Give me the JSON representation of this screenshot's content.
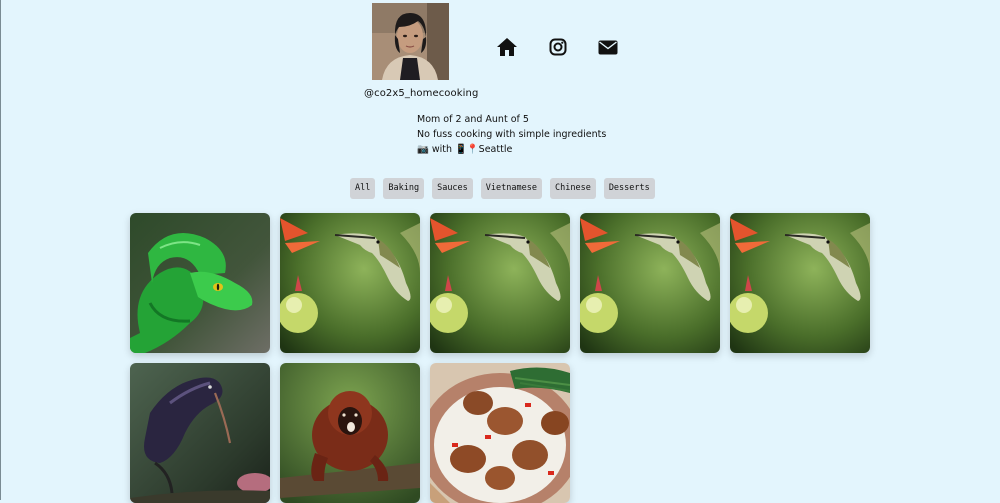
{
  "profile": {
    "handle": "@co2x5_homecooking",
    "bio": [
      "Mom of 2 and Aunt of 5",
      "No fuss cooking with simple ingredients",
      "📷 with 📱📍Seattle"
    ]
  },
  "nav": [
    {
      "icon": "home-icon"
    },
    {
      "icon": "instagram-icon"
    },
    {
      "icon": "email-icon"
    }
  ],
  "filters": [
    "All",
    "Baking",
    "Sauces",
    "Vietnamese",
    "Chinese",
    "Desserts"
  ],
  "gallery": [
    {
      "subject": "green-snake"
    },
    {
      "subject": "hummingbird"
    },
    {
      "subject": "hummingbird"
    },
    {
      "subject": "hummingbird"
    },
    {
      "subject": "hummingbird"
    },
    {
      "subject": "crow"
    },
    {
      "subject": "howler-monkey"
    },
    {
      "subject": "chicken-rice-dish"
    }
  ],
  "colors": {
    "background": "#e3f5fd",
    "filter_bg": "#d0d3d7",
    "text": "#111111"
  }
}
